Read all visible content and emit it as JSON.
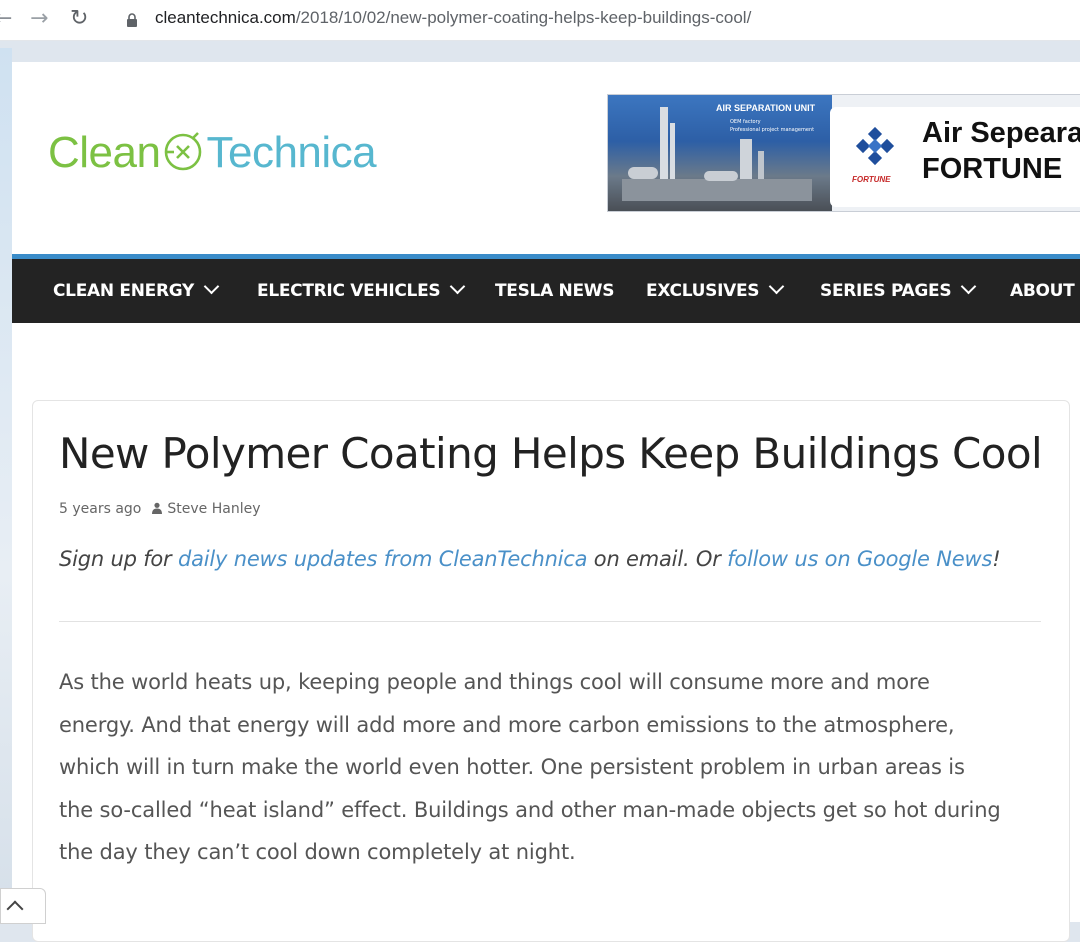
{
  "browser": {
    "url_host": "cleantechnica.com",
    "url_path": "/2018/10/02/new-polymer-coating-helps-keep-buildings-cool/",
    "icons": [
      "back-arrow-icon",
      "forward-arrow-icon",
      "reload-icon",
      "lock-icon"
    ]
  },
  "site": {
    "logo_left": "Clean",
    "logo_right": "Technica",
    "colors": {
      "green": "#7cc143",
      "teal": "#57b7cf",
      "accent": "#3a8cc9",
      "nav_bg": "#232323"
    }
  },
  "ad": {
    "photo_title": "AIR SEPARATION UNIT",
    "photo_bullets": [
      "OEM factory",
      "Professional project management"
    ],
    "brand_small": "FORTUNE",
    "line1": "Air Sepeara",
    "line2": "FORTUNE"
  },
  "nav": {
    "items": [
      {
        "label": "CLEAN ENERGY",
        "dropdown": true
      },
      {
        "label": "ELECTRIC VEHICLES",
        "dropdown": true
      },
      {
        "label": "TESLA NEWS",
        "dropdown": false
      },
      {
        "label": "EXCLUSIVES",
        "dropdown": true
      },
      {
        "label": "SERIES PAGES",
        "dropdown": true
      },
      {
        "label": "ABOUT",
        "dropdown": false
      }
    ]
  },
  "article": {
    "title": "New Polymer Coating Helps Keep Buildings Cool",
    "time": "5 years ago",
    "author": "Steve Hanley",
    "signup_prefix": "Sign up for ",
    "signup_link1": "daily news updates from CleanTechnica",
    "signup_mid": " on email. Or ",
    "signup_link2": "follow us on Google News",
    "signup_suffix": "!",
    "paragraph_lines": [
      "As the world heats up, keeping people and things cool will consume more and more",
      "energy. And that energy will add more and more carbon emissions to the atmosphere,",
      "which will in turn make the world even hotter. One persistent problem in urban areas is",
      "the so-called “heat island” effect. Buildings and other man-made objects get so hot during",
      "the day they can’t cool down completely at night."
    ]
  }
}
